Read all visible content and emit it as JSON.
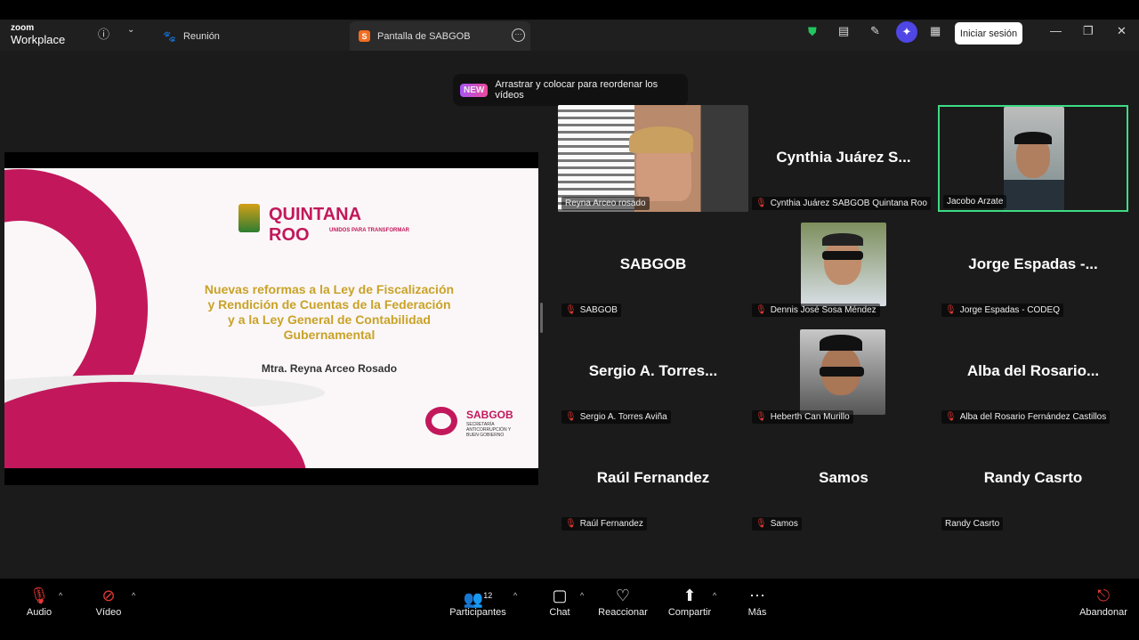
{
  "topbar": {
    "logo_line1": "zoom",
    "logo_line2": "Workplace",
    "info_icon": "info-icon",
    "meeting_tab": "Reunión",
    "share_tab": "Pantalla de SABGOB",
    "signin": "Iniciar sesión"
  },
  "toast": {
    "badge": "NEW",
    "text": "Arrastrar y colocar para reordenar los vídeos"
  },
  "slide": {
    "quintana": "QUINTANA",
    "roo": "ROO",
    "unidos": "UNIDOS PARA TRANSFORMAR",
    "title_lines": [
      "Nuevas reformas a la Ley de Fiscalización",
      "y Rendición de Cuentas de la Federación",
      "y a la Ley General de Contabilidad",
      "Gubernamental"
    ],
    "author": "Mtra. Reyna Arceo Rosado",
    "sabgob": "SABGOB",
    "sabgob_sub": "SECRETARÍA ANTICORRUPCIÓN Y BUEN GOBIERNO"
  },
  "participants": [
    {
      "display": "",
      "label": "Reyna Arceo rosado",
      "muted": false
    },
    {
      "display": "Cynthia Juárez S...",
      "label": "Cynthia Juárez SABGOB Quintana Roo",
      "muted": true
    },
    {
      "display": "",
      "label": "Jacobo Arzate",
      "muted": false
    },
    {
      "display": "SABGOB",
      "label": "SABGOB",
      "muted": true
    },
    {
      "display": "",
      "label": "Dennis José Sosa Méndez",
      "muted": true
    },
    {
      "display": "Jorge Espadas -...",
      "label": "Jorge Espadas - CODEQ",
      "muted": true
    },
    {
      "display": "Sergio A. Torres...",
      "label": "Sergio A. Torres Aviña",
      "muted": true
    },
    {
      "display": "",
      "label": "Heberth Can Murillo",
      "muted": true
    },
    {
      "display": "Alba del Rosario...",
      "label": "Alba del Rosario Fernández Castillos",
      "muted": true
    },
    {
      "display": "Raúl Fernandez",
      "label": "Raúl Fernandez",
      "muted": true
    },
    {
      "display": "Samos",
      "label": "Samos",
      "muted": true
    },
    {
      "display": "Randy Casrto",
      "label": "Randy Casrto",
      "muted": false
    }
  ],
  "bottombar": {
    "audio": "Audio",
    "video": "Vídeo",
    "participants": "Participantes",
    "participants_count": "12",
    "chat": "Chat",
    "react": "Reaccionar",
    "share": "Compartir",
    "more": "Más",
    "leave": "Abandonar"
  },
  "colors": {
    "accent": "#c2185b",
    "gold": "#c9a227",
    "active_speaker": "#3ddc84",
    "signin_bg": "#ffffff"
  }
}
